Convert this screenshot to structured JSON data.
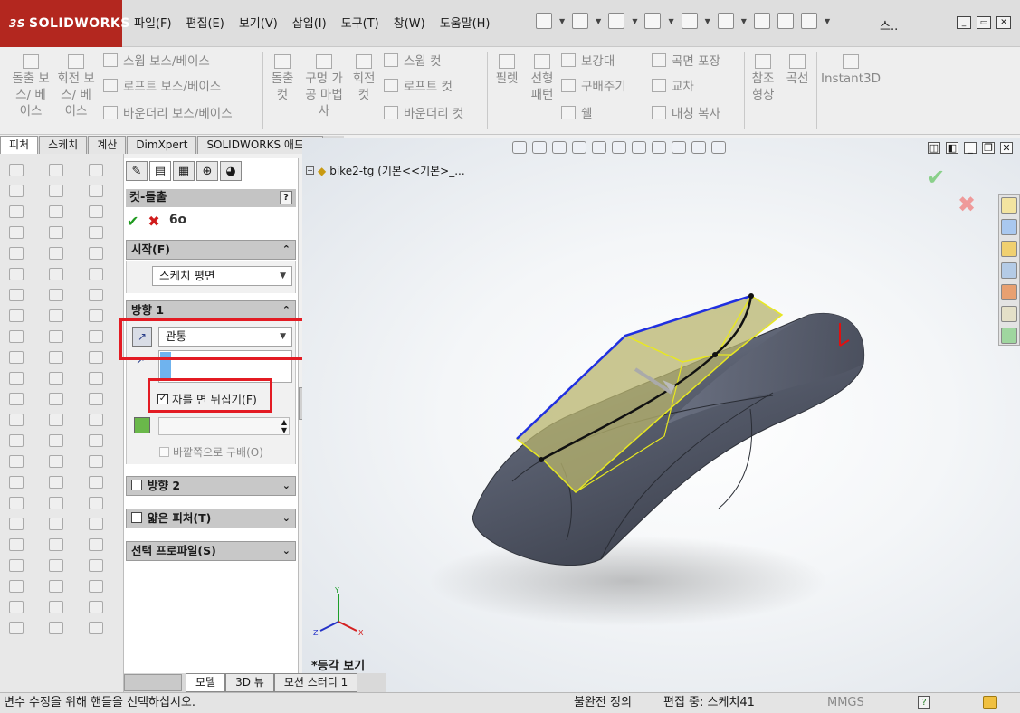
{
  "app": {
    "logo": "SOLIDWORKS",
    "logo_ds": "3S"
  },
  "menu": [
    {
      "label": "파일(F)"
    },
    {
      "label": "편집(E)"
    },
    {
      "label": "보기(V)"
    },
    {
      "label": "삽입(I)"
    },
    {
      "label": "도구(T)"
    },
    {
      "label": "창(W)"
    },
    {
      "label": "도움말(H)"
    }
  ],
  "quick_access": {
    "search": "스.."
  },
  "ribbon": {
    "extruded_boss": "돌출 보스/ 베이스",
    "revolved_boss": "회전 보스/ 베이스",
    "swept_boss": "스윕 보스/베이스",
    "lofted_boss": "로프트 보스/베이스",
    "boundary_boss": "바운더리 보스/베이스",
    "extruded_cut": "돌출 컷",
    "hole_wizard": "구멍 가공 마법사",
    "revolved_cut": "회전 컷",
    "swept_cut": "스윕 컷",
    "lofted_cut": "로프트 컷",
    "boundary_cut": "바운더리 컷",
    "fillet": "필렛",
    "linear_pattern": "선형 패턴",
    "rib": "보강대",
    "draft": "구배주기",
    "shell": "쉘",
    "wrap": "곡면 포장",
    "intersect": "교차",
    "mirror": "대칭 복사",
    "ref_geometry": "참조 형상",
    "curves": "곡선",
    "instant3d": "Instant3D"
  },
  "tabs": [
    {
      "label": "피처"
    },
    {
      "label": "스케치"
    },
    {
      "label": "계산"
    },
    {
      "label": "DimXpert"
    },
    {
      "label": "SOLIDWORKS 애드인"
    }
  ],
  "property_manager": {
    "title": "컷-돌출",
    "help": "?",
    "from": {
      "header": "시작(F)",
      "value": "스케치 평면"
    },
    "direction1": {
      "header": "방향 1",
      "end_condition": "관통",
      "flip_side_label": "자를 면 뒤집기(F)",
      "flip_side_checked": true,
      "draft_outward_label": "바깥쪽으로 구배(O)"
    },
    "direction2": {
      "header": "방향 2"
    },
    "thin_feature": {
      "header": "얇은 피처(T)"
    },
    "selected_contours": {
      "header": "선택 프로파일(S)"
    }
  },
  "viewport": {
    "tree_item": "bike2-tg  (기본<<기본>_...",
    "view_label": "*등각 보기",
    "triad": {
      "x": "X",
      "y": "Y",
      "z": "Z"
    }
  },
  "bottom_tabs": [
    {
      "label": "모델"
    },
    {
      "label": "3D 뷰"
    },
    {
      "label": "모션 스터디 1"
    }
  ],
  "status": {
    "message": "변수 수정을 위해 핸들을 선택하십시오.",
    "definition": "불완전 정의",
    "editing": "편집 중: 스케치41",
    "units": "MMGS",
    "help": "?"
  },
  "colors": {
    "brand": "#b3271f",
    "highlight_red": "#e31b23",
    "preview_fill": "#b8b46e",
    "body": "#5b6170"
  }
}
